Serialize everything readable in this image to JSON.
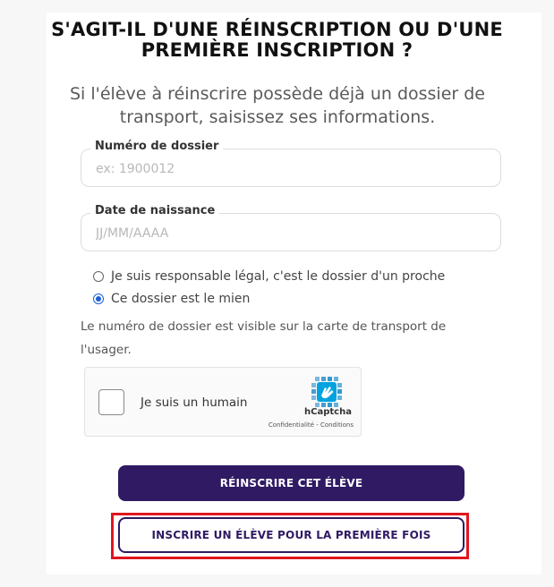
{
  "heading": {
    "line1": "S'AGIT-IL D'UNE RÉINSCRIPTION OU D'UNE",
    "line2": "PREMIÈRE INSCRIPTION ?"
  },
  "subtitle": {
    "line1": "Si l'élève à réinscrire possède déjà un dossier de",
    "line2": "transport, saisissez ses informations."
  },
  "fields": {
    "file_number": {
      "label": "Numéro de dossier",
      "placeholder": "ex: 1900012",
      "value": ""
    },
    "birth_date": {
      "label": "Date de naissance",
      "placeholder": "JJ/MM/AAAA",
      "value": ""
    }
  },
  "radios": {
    "guardian": {
      "label": "Je suis responsable légal, c'est le dossier d'un proche",
      "checked": false
    },
    "self": {
      "label": "Ce dossier est le mien",
      "checked": true
    }
  },
  "help_text": {
    "line1": "Le numéro de dossier est visible sur la carte de transport de",
    "line2": "l'usager."
  },
  "captcha": {
    "label": "Je suis un humain",
    "brand": "hCaptcha",
    "links": "Confidentialité - Conditions",
    "logo_icon": "hcaptcha-hand-icon",
    "checked": false
  },
  "buttons": {
    "reenroll": "RÉINSCRIRE CET ÉLÈVE",
    "first_enroll": "INSCRIRE UN ÉLÈVE POUR LA PREMIÈRE FOIS"
  },
  "colors": {
    "primary": "#2f1a63",
    "radio_selected": "#1a5fd6",
    "highlight": "#e0161e"
  }
}
